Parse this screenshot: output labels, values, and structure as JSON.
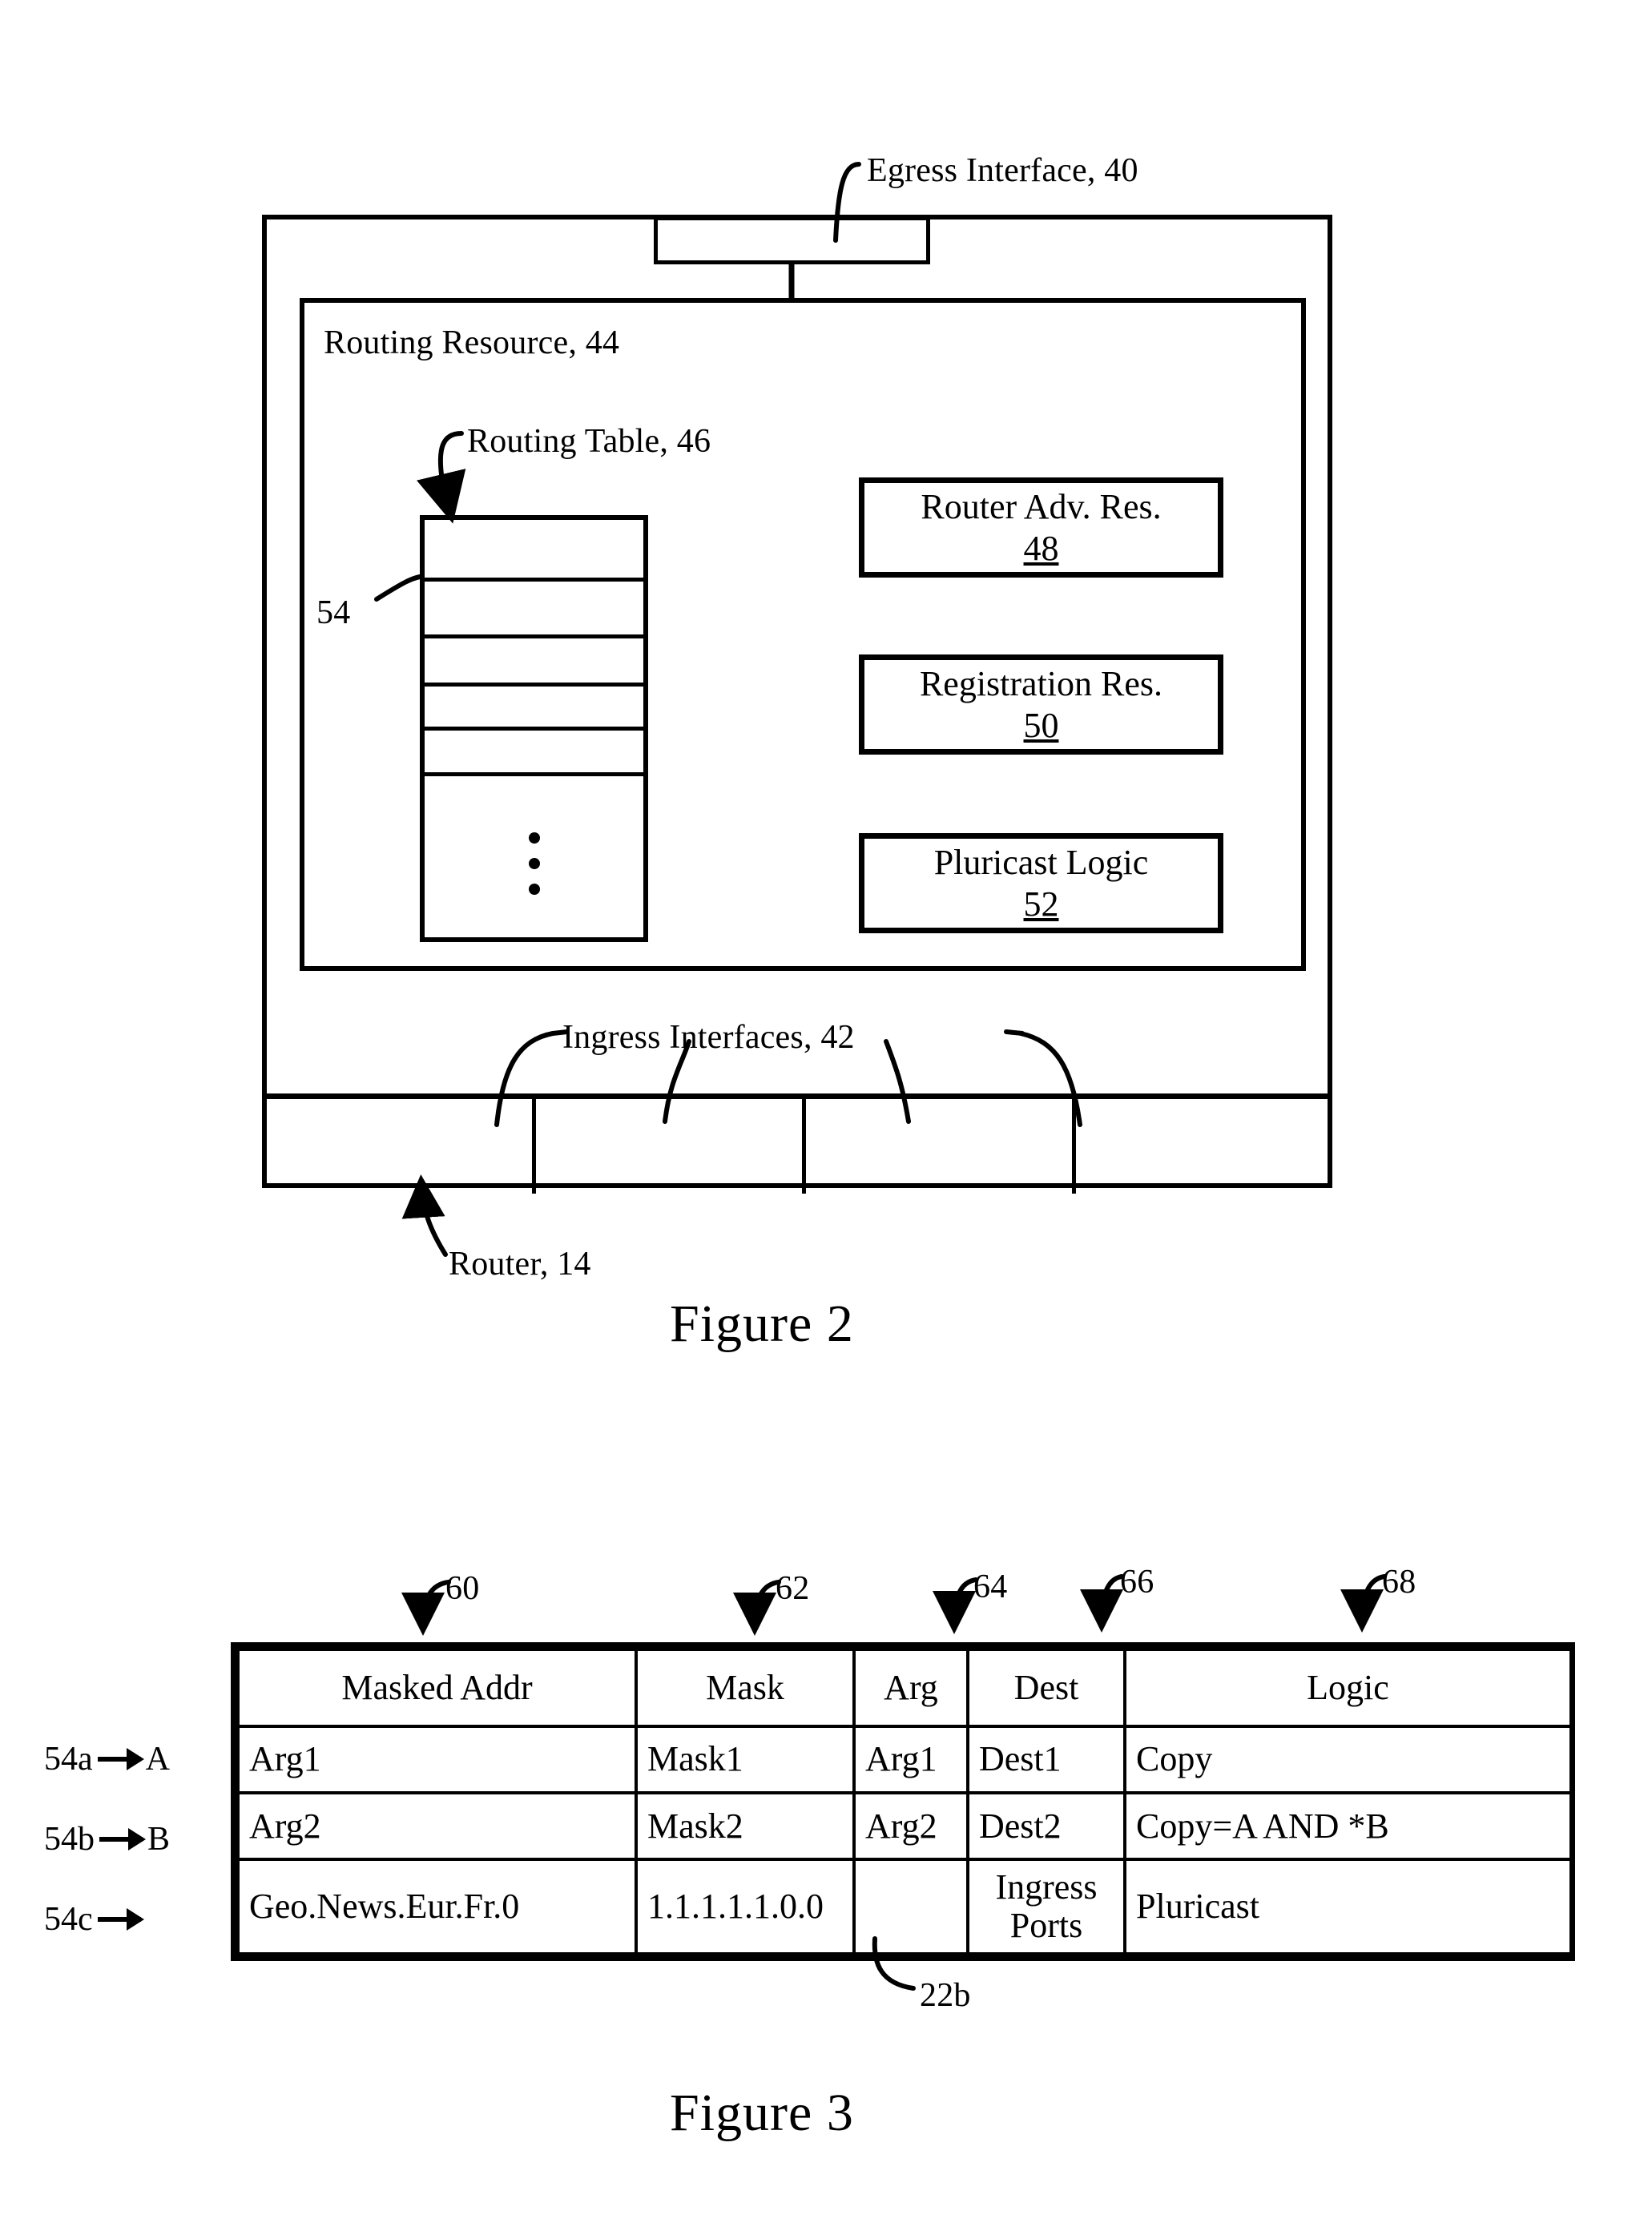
{
  "figure2": {
    "caption": "Figure 2",
    "callouts": {
      "egress": "Egress Interface, 40",
      "routing_resource": "Routing Resource, 44",
      "routing_table": "Routing Table, 46",
      "table_entry": "54",
      "ingress": "Ingress Interfaces, 42",
      "router": "Router, 14"
    },
    "resource_boxes": [
      {
        "label": "Router Adv. Res.",
        "number": "48"
      },
      {
        "label": "Registration Res.",
        "number": "50"
      },
      {
        "label": "Pluricast Logic",
        "number": "52"
      }
    ],
    "routing_table_rows": 6,
    "ingress_port_count": 4,
    "ellipsis": "vertical-dots"
  },
  "figure3": {
    "caption": "Figure 3",
    "column_callouts": [
      "60",
      "62",
      "64",
      "66",
      "68"
    ],
    "table_callout": "22b",
    "row_callouts": [
      {
        "ref": "54a",
        "letter": "A"
      },
      {
        "ref": "54b",
        "letter": "B"
      },
      {
        "ref": "54c",
        "letter": ""
      }
    ],
    "headers": [
      "Masked Addr",
      "Mask",
      "Arg",
      "Dest",
      "Logic"
    ],
    "rows": [
      {
        "masked_addr": "Arg1",
        "mask": "Mask1",
        "arg": "Arg1",
        "dest": "Dest1",
        "logic": "Copy"
      },
      {
        "masked_addr": "Arg2",
        "mask": "Mask2",
        "arg": "Arg2",
        "dest": "Dest2",
        "logic": "Copy=A AND *B"
      },
      {
        "masked_addr": "Geo.News.Eur.Fr.0",
        "mask": "1.1.1.1.1.0.0",
        "arg": "",
        "dest_line1": "Ingress",
        "dest_line2": "Ports",
        "logic": "Pluricast"
      }
    ]
  },
  "colors": {
    "ink": "#000000",
    "paper": "#ffffff"
  }
}
